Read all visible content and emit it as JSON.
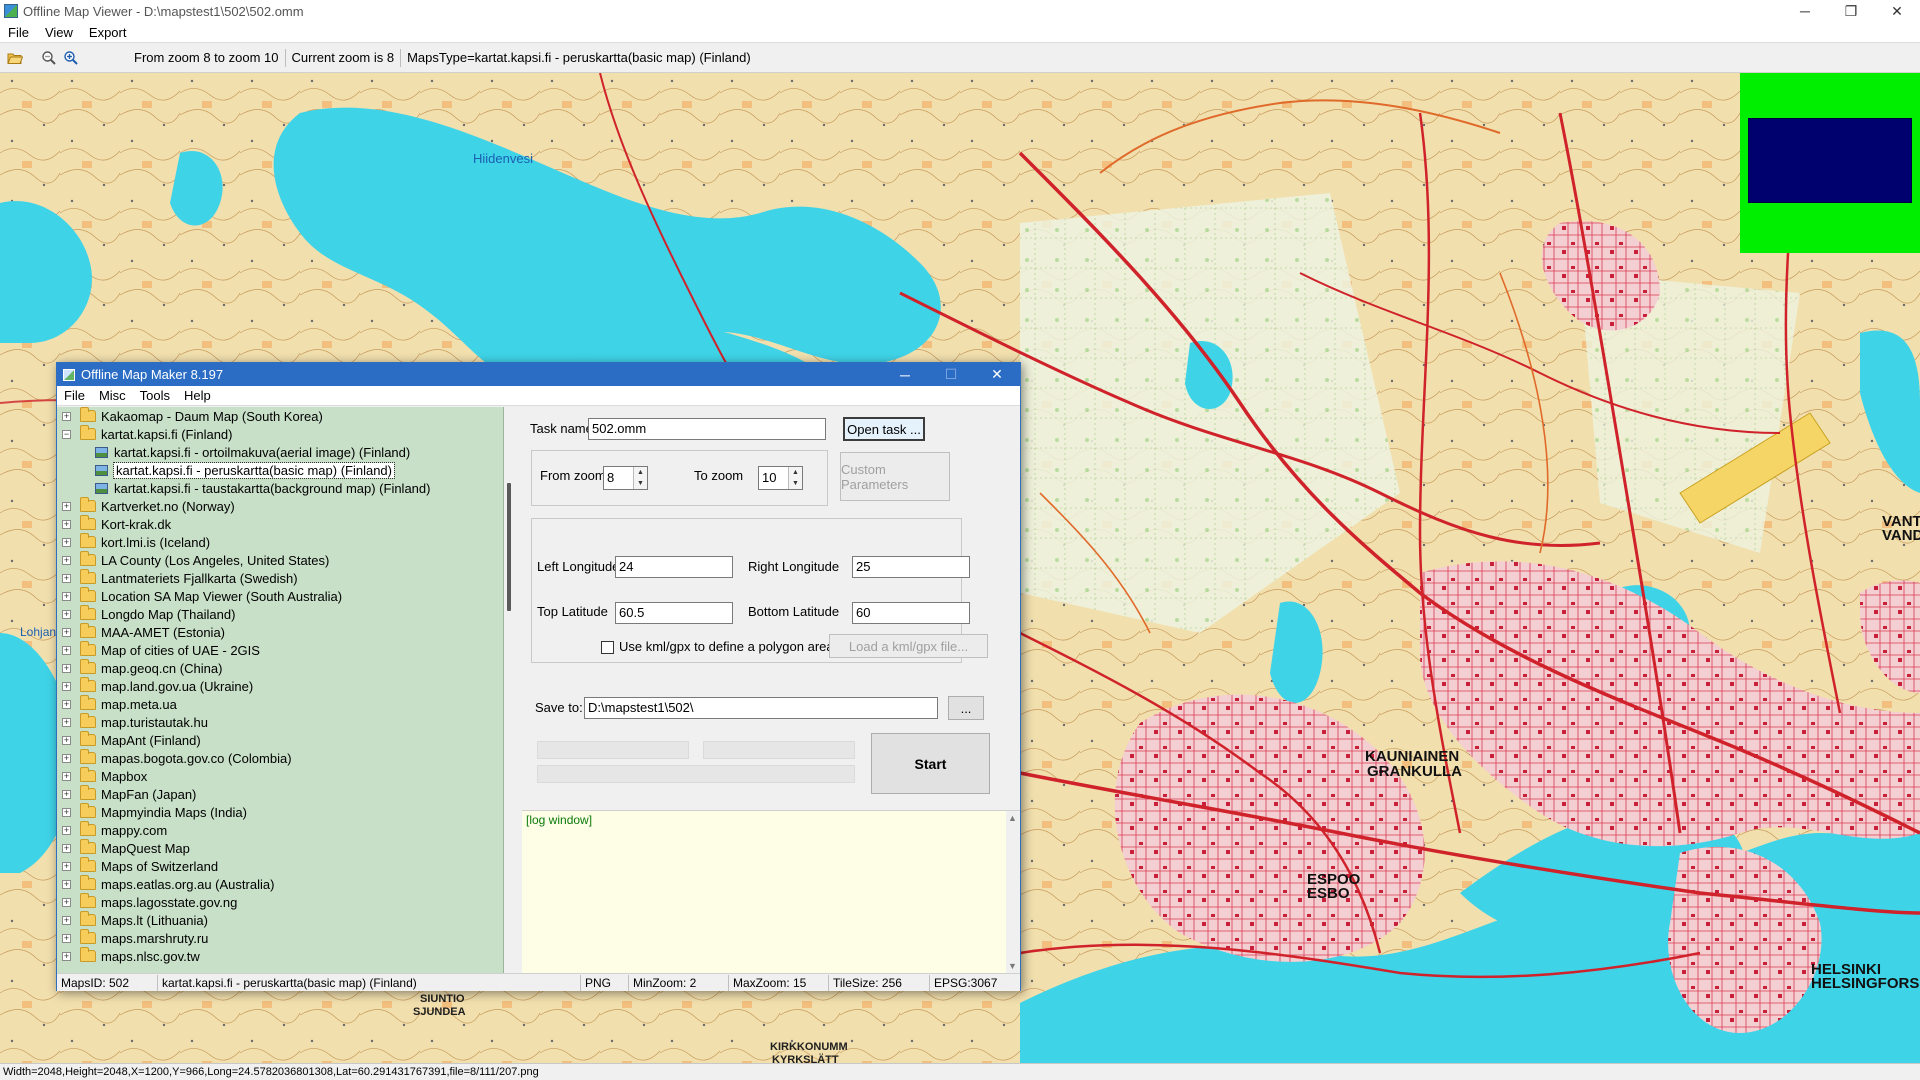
{
  "window": {
    "title": "Offline Map Viewer - D:\\mapstest1\\502\\502.omm",
    "minimize": "─",
    "restore": "❐",
    "close": "✕"
  },
  "menu": [
    "File",
    "View",
    "Export"
  ],
  "toolbar": {
    "zoom_range": "From zoom 8 to zoom 10",
    "current_zoom": "Current zoom is 8",
    "maps_type": "MapsType=kartat.kapsi.fi - peruskartta(basic map) (Finland)"
  },
  "map": {
    "labels": {
      "hiidenvesi": "Hiidenvesi",
      "kauniainen": "KAUNIAINEN",
      "grankulla": "GRANKULLA",
      "espoo": "ESPOO",
      "esbo": "ESBO",
      "helsinki": "HELSINKI",
      "helsingfors": "HELSINGFORS",
      "lohja": "Lohjan",
      "vanta": "VANT",
      "vanda": "VAND",
      "siuntio": "SIUNTIO",
      "sjundea": "SJUNDEA",
      "kirkkonummi": "KIRKKONUMM",
      "kyrkslatt": "KYRKSLÄTT"
    }
  },
  "statusline": "Width=2048,Height=2048,X=1200,Y=966,Long=24.5782036801308,Lat=60.291431767391,file=8/111/207.png",
  "dialog": {
    "title": "Offline Map Maker 8.197",
    "minimize": "─",
    "maximize": "☐",
    "close": "✕",
    "menu": [
      "File",
      "Misc",
      "Tools",
      "Help"
    ],
    "tree": [
      {
        "label": "Kakaomap - Daum Map (South Korea)",
        "level": 0,
        "expander": "+"
      },
      {
        "label": "kartat.kapsi.fi (Finland)",
        "level": 0,
        "expander": "−",
        "open": true
      },
      {
        "label": "kartat.kapsi.fi - ortoilmakuva(aerial image) (Finland)",
        "level": 1
      },
      {
        "label": "kartat.kapsi.fi - peruskartta(basic map) (Finland)",
        "level": 1,
        "selected": true
      },
      {
        "label": "kartat.kapsi.fi - taustakartta(background map) (Finland)",
        "level": 1
      },
      {
        "label": "Kartverket.no (Norway)",
        "level": 0,
        "expander": "+"
      },
      {
        "label": "Kort-krak.dk",
        "level": 0,
        "expander": "+"
      },
      {
        "label": "kort.lmi.is (Iceland)",
        "level": 0,
        "expander": "+"
      },
      {
        "label": "LA County (Los Angeles, United States)",
        "level": 0,
        "expander": "+"
      },
      {
        "label": "Lantmateriets Fjallkarta (Swedish)",
        "level": 0,
        "expander": "+"
      },
      {
        "label": "Location SA Map Viewer (South Australia)",
        "level": 0,
        "expander": "+"
      },
      {
        "label": "Longdo Map (Thailand)",
        "level": 0,
        "expander": "+"
      },
      {
        "label": "MAA-AMET (Estonia)",
        "level": 0,
        "expander": "+"
      },
      {
        "label": "Map of cities of UAE - 2GIS",
        "level": 0,
        "expander": "+"
      },
      {
        "label": "map.geoq.cn (China)",
        "level": 0,
        "expander": "+"
      },
      {
        "label": "map.land.gov.ua (Ukraine)",
        "level": 0,
        "expander": "+"
      },
      {
        "label": "map.meta.ua",
        "level": 0,
        "expander": "+"
      },
      {
        "label": "map.turistautak.hu",
        "level": 0,
        "expander": "+"
      },
      {
        "label": "MapAnt (Finland)",
        "level": 0,
        "expander": "+"
      },
      {
        "label": "mapas.bogota.gov.co (Colombia)",
        "level": 0,
        "expander": "+"
      },
      {
        "label": "Mapbox",
        "level": 0,
        "expander": "+"
      },
      {
        "label": "MapFan (Japan)",
        "level": 0,
        "expander": "+"
      },
      {
        "label": "Mapmyindia Maps (India)",
        "level": 0,
        "expander": "+"
      },
      {
        "label": "mappy.com",
        "level": 0,
        "expander": "+"
      },
      {
        "label": "MapQuest Map",
        "level": 0,
        "expander": "+"
      },
      {
        "label": "Maps of Switzerland",
        "level": 0,
        "expander": "+"
      },
      {
        "label": "maps.eatlas.org.au (Australia)",
        "level": 0,
        "expander": "+"
      },
      {
        "label": "maps.lagosstate.gov.ng",
        "level": 0,
        "expander": "+"
      },
      {
        "label": "Maps.lt (Lithuania)",
        "level": 0,
        "expander": "+"
      },
      {
        "label": "maps.marshruty.ru",
        "level": 0,
        "expander": "+"
      },
      {
        "label": "maps.nlsc.gov.tw",
        "level": 0,
        "expander": "+"
      }
    ],
    "task": {
      "label": "Task name",
      "value": "502.omm",
      "open_button": "Open task ..."
    },
    "zoom": {
      "from_label": "From zoom",
      "from_value": "8",
      "to_label": "To zoom",
      "to_value": "10",
      "custom_button": "Custom Parameters"
    },
    "area": {
      "left_lon_label": "Left Longitude",
      "left_lon": "24",
      "right_lon_label": "Right Longitude",
      "right_lon": "25",
      "top_lat_label": "Top Latitude",
      "top_lat": "60.5",
      "bottom_lat_label": "Bottom Latitude",
      "bottom_lat": "60",
      "kml_label": "Use kml/gpx to define a polygon area",
      "kml_button": "Load a kml/gpx file..."
    },
    "save": {
      "label": "Save to:",
      "value": "D:\\mapstest1\\502\\",
      "browse": "..."
    },
    "start_button": "Start",
    "log_text": "[log window]",
    "status": {
      "maps_id": "MapsID: 502",
      "maps_name": "kartat.kapsi.fi - peruskartta(basic map) (Finland)",
      "format": "PNG",
      "min_zoom": "MinZoom: 2",
      "max_zoom": "MaxZoom: 15",
      "tile_size": "TileSize: 256",
      "epsg": "EPSG:3067"
    }
  },
  "colors": {
    "dialog_title": "#2b6cc4",
    "tree_bg": "#c8dfc8",
    "log_bg": "#fefee6",
    "minimap_bg": "#00ee00",
    "minimap_view": "#00006e",
    "water": "#3fd3e8",
    "road": "#d0222a"
  }
}
